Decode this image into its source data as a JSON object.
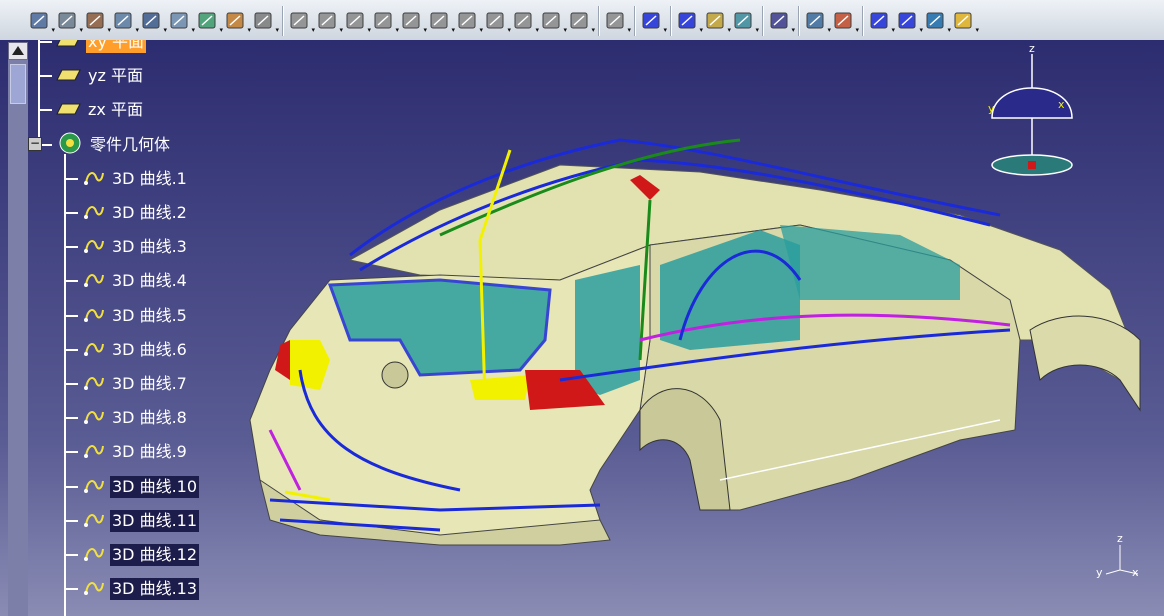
{
  "toolbar": {
    "buttons": [
      "sketch-icon",
      "plane-icon",
      "part-body-icon",
      "extrude-icon",
      "pocket-icon",
      "revolve-icon",
      "box-icon",
      "sweep-icon",
      "fill-icon",
      "render-style-icon",
      "sphere-icon",
      "cube-icon",
      "cylinder-icon",
      "chamfer-icon",
      "fillet-icon",
      "axis-icon",
      "blend-icon",
      "clip-icon",
      "mirror-icon",
      "pattern-icon",
      "compass-icon",
      "point-icon",
      "line-icon",
      "plane-tool-icon",
      "surface-icon",
      "annotation-icon",
      "text-icon",
      "analysis-icon",
      "point2-icon",
      "spline-icon",
      "curve-icon",
      "render-icon"
    ]
  },
  "tree": {
    "items": [
      {
        "label": "xy 平面",
        "kind": "plane",
        "highlight": true
      },
      {
        "label": "yz 平面",
        "kind": "plane"
      },
      {
        "label": "zx 平面",
        "kind": "plane"
      },
      {
        "label": "零件几何体",
        "kind": "body"
      },
      {
        "label": "3D 曲线.1",
        "kind": "curve"
      },
      {
        "label": "3D 曲线.2",
        "kind": "curve"
      },
      {
        "label": "3D 曲线.3",
        "kind": "curve"
      },
      {
        "label": "3D 曲线.4",
        "kind": "curve"
      },
      {
        "label": "3D 曲线.5",
        "kind": "curve"
      },
      {
        "label": "3D 曲线.6",
        "kind": "curve"
      },
      {
        "label": "3D 曲线.7",
        "kind": "curve"
      },
      {
        "label": "3D 曲线.8",
        "kind": "curve"
      },
      {
        "label": "3D 曲线.9",
        "kind": "curve"
      },
      {
        "label": "3D 曲线.10",
        "kind": "curve"
      },
      {
        "label": "3D 曲线.11",
        "kind": "curve"
      },
      {
        "label": "3D 曲线.12",
        "kind": "curve"
      },
      {
        "label": "3D 曲线.13",
        "kind": "curve"
      }
    ]
  },
  "compass": {
    "z": "z",
    "y": "y",
    "x": "x"
  },
  "axis_triad": {
    "z": "z",
    "y": "y",
    "x": "x"
  },
  "colors": {
    "surface": "#e8e8b8",
    "curve_blue": "#1a2ad8",
    "curve_green": "#1a8a1a",
    "curve_yellow": "#f2f200",
    "curve_magenta": "#c020e0",
    "glass": "#2a9e9e",
    "tail_red": "#d01818",
    "highlight": "#ff9e2a"
  }
}
